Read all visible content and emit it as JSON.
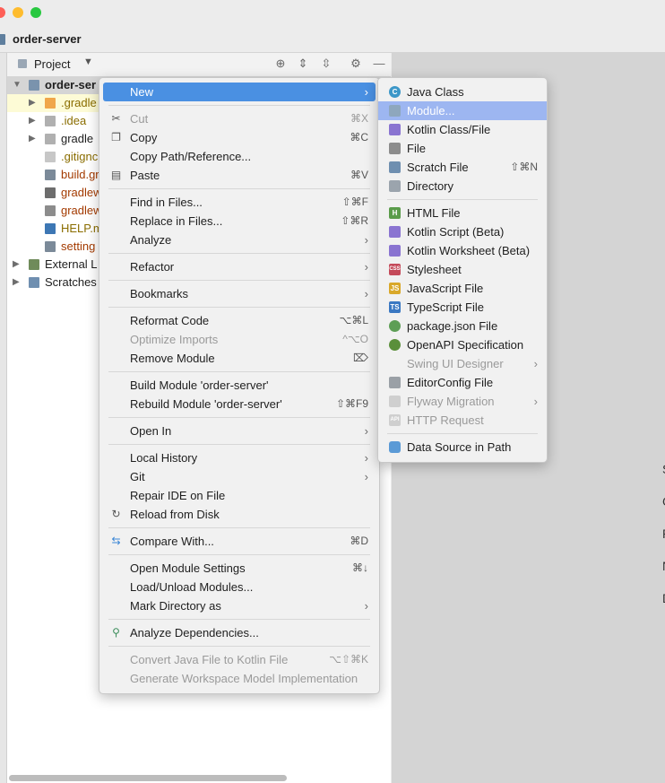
{
  "window": {
    "title": "order-server"
  },
  "project_panel": {
    "view_label": "Project",
    "tree": [
      {
        "label": "order-ser",
        "bold": true
      },
      {
        "label": ".gradle"
      },
      {
        "label": ".idea"
      },
      {
        "label": "gradle"
      },
      {
        "label": ".gitignc"
      },
      {
        "label": "build.gr"
      },
      {
        "label": "gradlew"
      },
      {
        "label": "gradlew"
      },
      {
        "label": "HELP.m"
      },
      {
        "label": "setting"
      },
      {
        "label": "External L"
      },
      {
        "label": "Scratches"
      }
    ]
  },
  "editor_hints": [
    "S",
    "G",
    "R",
    "N",
    "D"
  ],
  "context_menu": {
    "items": [
      {
        "label": "New"
      },
      {
        "label": "Cut",
        "shortcut": "⌘X"
      },
      {
        "label": "Copy",
        "shortcut": "⌘C"
      },
      {
        "label": "Copy Path/Reference..."
      },
      {
        "label": "Paste",
        "shortcut": "⌘V"
      },
      {
        "label": "Find in Files...",
        "shortcut": "⇧⌘F"
      },
      {
        "label": "Replace in Files...",
        "shortcut": "⇧⌘R"
      },
      {
        "label": "Analyze"
      },
      {
        "label": "Refactor"
      },
      {
        "label": "Bookmarks"
      },
      {
        "label": "Reformat Code",
        "shortcut": "⌥⌘L"
      },
      {
        "label": "Optimize Imports",
        "shortcut": "^⌥O"
      },
      {
        "label": "Remove Module",
        "shortcut": "⌦"
      },
      {
        "label": "Build Module 'order-server'"
      },
      {
        "label": "Rebuild Module 'order-server'",
        "shortcut": "⇧⌘F9"
      },
      {
        "label": "Open In"
      },
      {
        "label": "Local History"
      },
      {
        "label": "Git"
      },
      {
        "label": "Repair IDE on File"
      },
      {
        "label": "Reload from Disk"
      },
      {
        "label": "Compare With...",
        "shortcut": "⌘D"
      },
      {
        "label": "Open Module Settings",
        "shortcut": "⌘↓"
      },
      {
        "label": "Load/Unload Modules..."
      },
      {
        "label": "Mark Directory as"
      },
      {
        "label": "Analyze Dependencies..."
      },
      {
        "label": "Convert Java File to Kotlin File",
        "shortcut": "⌥⇧⌘K"
      },
      {
        "label": "Generate Workspace Model Implementation"
      }
    ]
  },
  "new_submenu": {
    "items": [
      {
        "label": "Java Class",
        "icon_text": "C"
      },
      {
        "label": "Module..."
      },
      {
        "label": "Kotlin Class/File"
      },
      {
        "label": "File"
      },
      {
        "label": "Scratch File",
        "shortcut": "⇧⌘N"
      },
      {
        "label": "Directory"
      },
      {
        "label": "HTML File",
        "icon_text": "H"
      },
      {
        "label": "Kotlin Script (Beta)"
      },
      {
        "label": "Kotlin Worksheet (Beta)"
      },
      {
        "label": "Stylesheet",
        "icon_text": "CSS"
      },
      {
        "label": "JavaScript File",
        "icon_text": "JS"
      },
      {
        "label": "TypeScript File",
        "icon_text": "TS"
      },
      {
        "label": "package.json File"
      },
      {
        "label": "OpenAPI Specification"
      },
      {
        "label": "Swing UI Designer"
      },
      {
        "label": "EditorConfig File"
      },
      {
        "label": "Flyway Migration"
      },
      {
        "label": "HTTP Request",
        "icon_text": "API"
      },
      {
        "label": "Data Source in Path"
      }
    ]
  },
  "colors": {
    "selection": "#4a90e2",
    "selection_light": "#9db6f1",
    "highlight_row": "#fdfbd6"
  }
}
